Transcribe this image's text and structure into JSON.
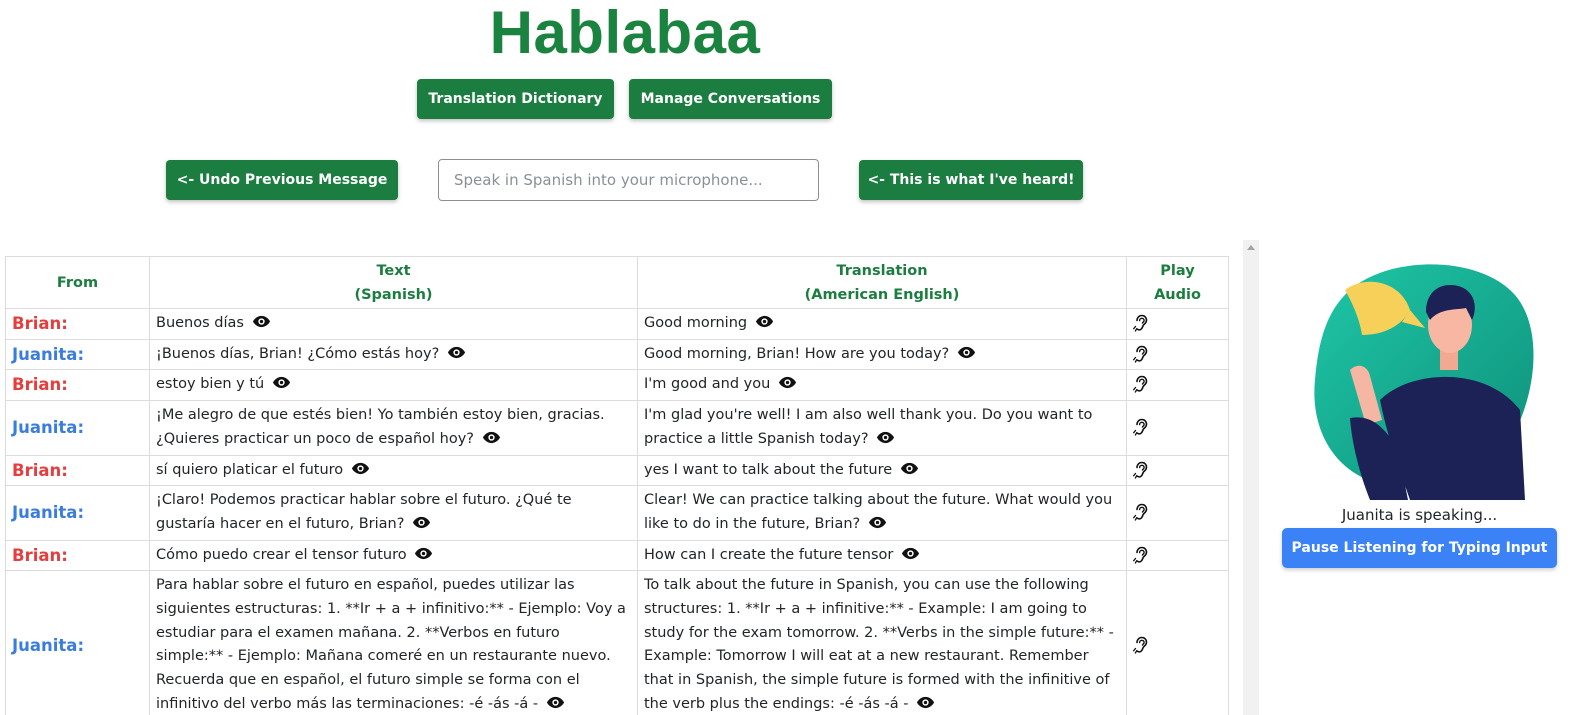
{
  "app": {
    "title": "Hablabaa"
  },
  "nav": {
    "dictionary_label": "Translation Dictionary",
    "conversations_label": "Manage Conversations"
  },
  "controls": {
    "undo_label": "<- Undo Previous Message",
    "input_placeholder": "Speak in Spanish into your microphone...",
    "input_value": "",
    "heard_label": "<- This is what I've heard!"
  },
  "table": {
    "headers": {
      "from": "From",
      "text_line1": "Text",
      "text_line2": "(Spanish)",
      "translation_line1": "Translation",
      "translation_line2": "(American English)",
      "play_line1": "Play",
      "play_line2": "Audio"
    },
    "rows": [
      {
        "speaker": "Brian:",
        "text": "Buenos días",
        "translation": "Good morning"
      },
      {
        "speaker": "Juanita:",
        "text": "¡Buenos días, Brian! ¿Cómo estás hoy?",
        "translation": "Good morning, Brian! How are you today?"
      },
      {
        "speaker": "Brian:",
        "text": "estoy bien y tú",
        "translation": "I'm good and you"
      },
      {
        "speaker": "Juanita:",
        "text": "¡Me alegro de que estés bien! Yo también estoy bien, gracias. ¿Quieres practicar un poco de español hoy?",
        "translation": "I'm glad you're well! I am also well thank you. Do you want to practice a little Spanish today?"
      },
      {
        "speaker": "Brian:",
        "text": "sí quiero platicar el futuro",
        "translation": "yes I want to talk about the future"
      },
      {
        "speaker": "Juanita:",
        "text": "¡Claro! Podemos practicar hablar sobre el futuro. ¿Qué te gustaría hacer en el futuro, Brian?",
        "translation": "Clear! We can practice talking about the future. What would you like to do in the future, Brian?"
      },
      {
        "speaker": "Brian:",
        "text": "Cómo puedo crear el tensor futuro",
        "translation": "How can I create the future tensor"
      },
      {
        "speaker": "Juanita:",
        "text": "Para hablar sobre el futuro en español, puedes utilizar las siguientes estructuras: 1. **Ir + a + infinitivo:** - Ejemplo: Voy a estudiar para el examen mañana. 2. **Verbos en futuro simple:** - Ejemplo: Mañana comeré en un restaurante nuevo. Recuerda que en español, el futuro simple se forma con el infinitivo del verbo más las terminaciones: -é -ás -á -",
        "translation": "To talk about the future in Spanish, you can use the following structures: 1. **Ir + a + infinitive:** - Example: I am going to study for the exam tomorrow. 2. **Verbs in the simple future:** - Example: Tomorrow I will eat at a new restaurant. Remember that in Spanish, the simple future is formed with the infinitive of the verb plus the endings: -é -ás -á -"
      }
    ]
  },
  "assistant": {
    "status": "Juanita is speaking...",
    "pause_label": "Pause Listening for Typing Input"
  },
  "colors": {
    "brand_green": "#1b7d3f",
    "brian": "#e53e3e",
    "juanita": "#3b7ddd",
    "pause_button": "#3b82f6"
  },
  "icons": {
    "reveal": "eye-icon",
    "play": "ear-icon"
  }
}
